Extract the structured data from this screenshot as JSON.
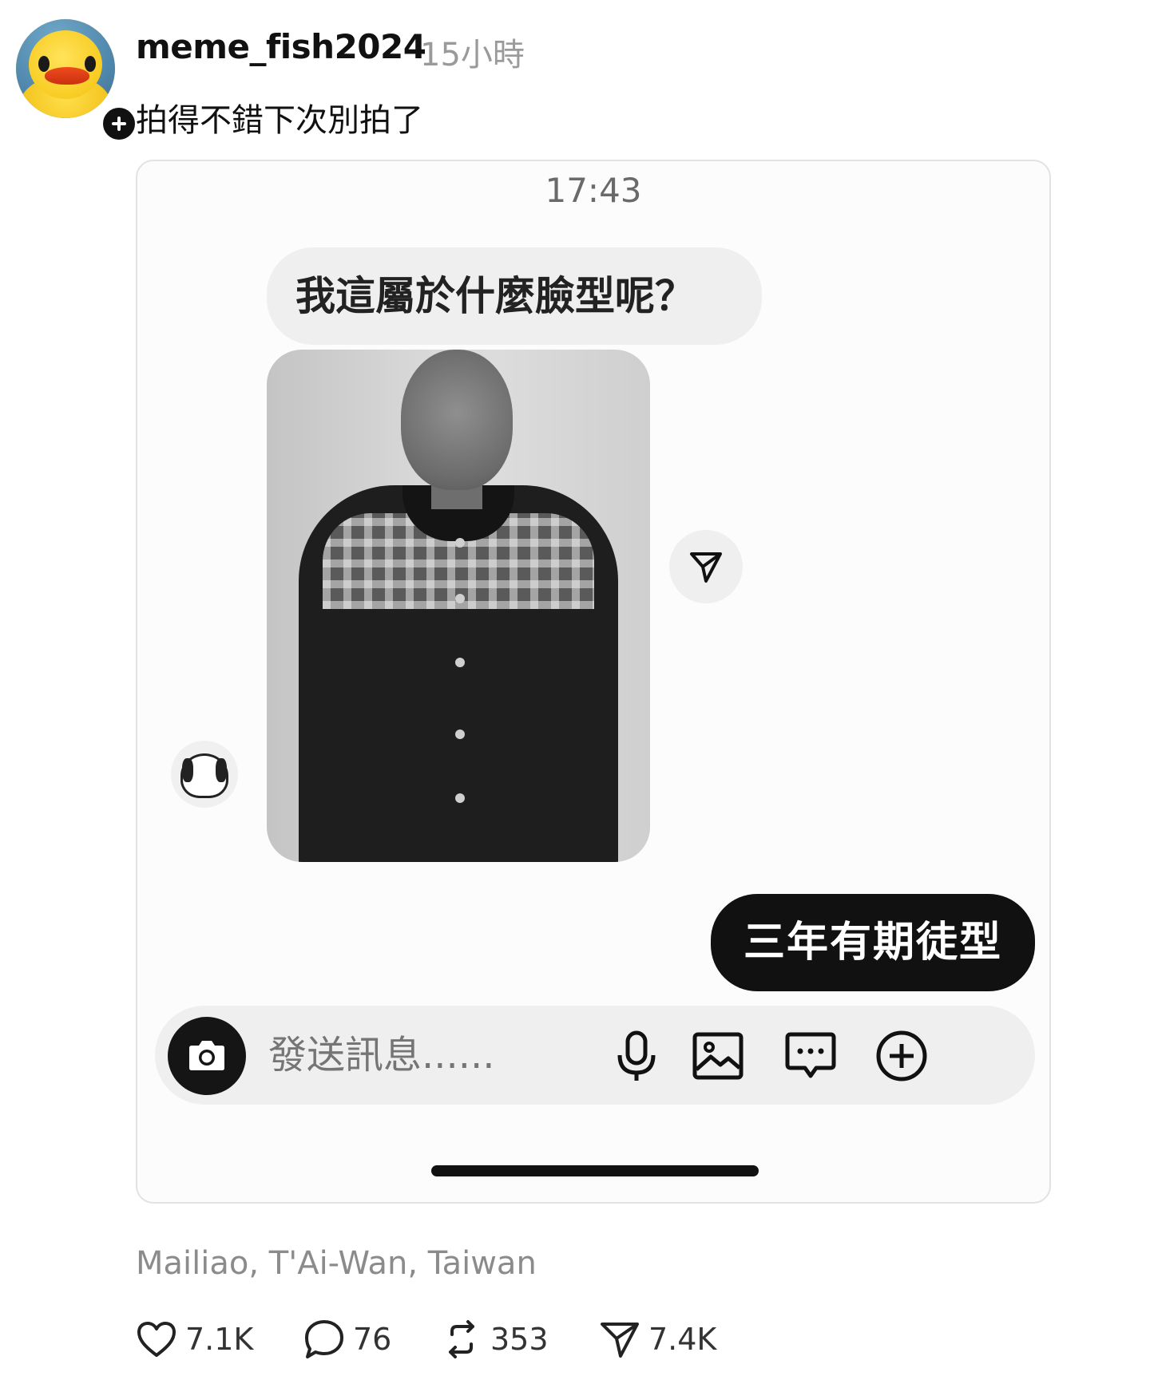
{
  "post": {
    "username": "meme_fish2024",
    "time_ago": "15小時",
    "caption": "拍得不錯下次別拍了",
    "location": "Mailiao, T'Ai-Wan, Taiwan"
  },
  "screenshot": {
    "chat_time": "17:43",
    "incoming_message": "我這屬於什麼臉型呢？",
    "outgoing_message": "三年有期徒型",
    "composer_placeholder": "發送訊息......"
  },
  "stats": {
    "likes": "7.1K",
    "comments": "76",
    "reposts": "353",
    "shares": "7.4K"
  },
  "icons": {
    "avatar": "rubber-duck",
    "follow": "plus-icon",
    "share_reply": "send-icon",
    "camera": "camera-icon",
    "mic": "microphone-icon",
    "gallery": "image-icon",
    "sticker": "chat-bubble-icon",
    "more": "plus-circle-icon",
    "like": "heart-icon",
    "comment": "comment-icon",
    "repost": "repost-icon",
    "share": "send-icon"
  },
  "colors": {
    "accent": "#111111",
    "muted_text": "#9a9a9a",
    "bubble_incoming": "#efefef",
    "bubble_outgoing": "#111111"
  }
}
